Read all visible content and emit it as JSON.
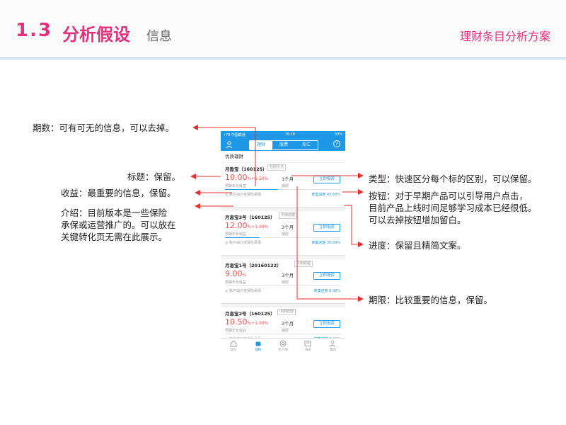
{
  "header": {
    "section_number": "1.3",
    "title": "分析假设",
    "subtitle": "信息",
    "right_title": "理财条目分析方案"
  },
  "annotations": {
    "period": "期数：可有可无的信息，可以去掉。",
    "title": "标题：保留。",
    "yield": "收益：最重要的信息，保留。",
    "intro_line1": "介绍：目前版本是一些保险",
    "intro_line2": "承保或运营推广的。可以放在",
    "intro_line3": "关键转化页无需在此展示。",
    "type": "类型：快速区分每个标的区别，可以保留。",
    "button_line1": "按钮：对于早期产品可以引导用户点击，",
    "button_line2": "目前产品上线时间足够学习成本已经很低。",
    "button_line3": "可以去掉按钮增加留白。",
    "progress": "进度：保留且精简文案。",
    "term": "期限：比较重要的信息，保留。"
  },
  "phone": {
    "status": {
      "carrier": "•78 中国联通",
      "time": "15:10",
      "battery": "33%"
    },
    "tabs": [
      "理财",
      "股票",
      "外汇"
    ],
    "active_tab": 0,
    "section_title": "优质理财",
    "products": [
      {
        "name": "月盈宝（160125）",
        "tag": "短期灵活",
        "rate": "10.00",
        "pct": "%",
        "bonus": "+1.50%",
        "rate_label": "预期年化收益",
        "term": "1个月",
        "term_label": "期限",
        "button": "立即投资",
        "guarantee": "账户由众安保险承保",
        "progress_text": "筹集进度 45.60%",
        "progress": 0.456
      },
      {
        "name": "月息宝3号（160125）",
        "tag": "中期稳健",
        "rate": "12.00",
        "pct": "%",
        "bonus": "+1.00%",
        "rate_label": "预期年化收益",
        "term": "3个月",
        "term_label": "期限",
        "button": "立即投资",
        "guarantee": "账户由众安保险承保",
        "progress_text": "筹集进度 30.00%",
        "progress": 0.3
      },
      {
        "name": "月息宝1号（20160122）",
        "tag": "中期稳健",
        "rate": "9.00",
        "pct": "%",
        "bonus": "",
        "rate_label": "预期年化收益",
        "term": "3个月",
        "term_label": "期限",
        "button": "立即投资",
        "guarantee": "账户由众安保险承保",
        "progress_text": "筹集进度 0.00%",
        "progress": 0
      },
      {
        "name": "月息宝2号（160125）",
        "tag": "中期稳健",
        "rate": "10.50",
        "pct": "%",
        "bonus": "+1.00%",
        "rate_label": "预期年化收益",
        "term": "3个月",
        "term_label": "期限",
        "button": "立即投资",
        "guarantee": "账户由众安保险承保",
        "progress_text": "筹集进度 0.00%",
        "progress": 0
      }
    ],
    "tabbar": [
      "首页",
      "理财",
      "生人圈",
      "资讯",
      "我的"
    ],
    "active_tabbar": 1
  },
  "colors": {
    "accent": "#e6307a",
    "app_blue": "#1e98e6",
    "arrow_red": "#e8312f",
    "rate_red": "#f04e4e"
  }
}
